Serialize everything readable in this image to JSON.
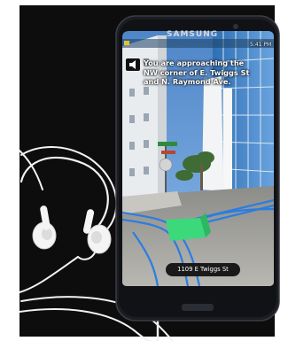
{
  "phone": {
    "brand": "SAMSUNG",
    "status_time": "5:41 PM"
  },
  "navigation": {
    "alert_text": "You are approaching the NW corner of E. Twiggs St and N. Raymond Ave.",
    "address_label": "1109 E Twiggs St"
  },
  "icons": [
    "speaker-icon"
  ],
  "colors": {
    "background": "#ffffff",
    "table": "#111111",
    "phone_body": "#1b1d22",
    "crosswalk_highlight": "#3bd97a",
    "route_lines": "#2a7de1",
    "address_pill": "#1a1a1a"
  }
}
